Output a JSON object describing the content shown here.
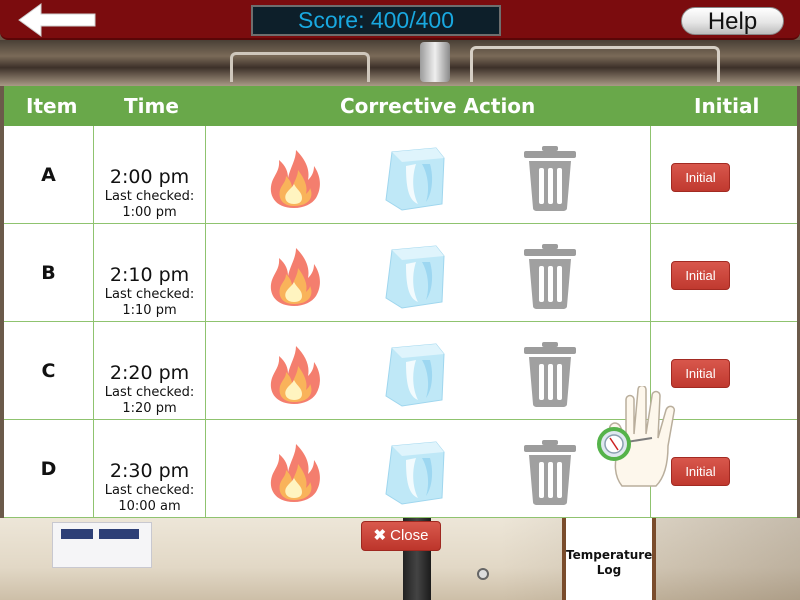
{
  "header": {
    "back_icon": "left-arrow-icon",
    "score": "Score: 400/400",
    "help_label": "Help"
  },
  "table": {
    "columns": [
      "Item",
      "Time",
      "Corrective Action",
      "Initial"
    ],
    "rows": [
      {
        "item": "A",
        "time": "2:00 pm",
        "last_checked_label": "Last checked:",
        "last_checked": "1:00 pm",
        "initial_label": "Initial"
      },
      {
        "item": "B",
        "time": "2:10 pm",
        "last_checked_label": "Last checked:",
        "last_checked": "1:10 pm",
        "initial_label": "Initial"
      },
      {
        "item": "C",
        "time": "2:20 pm",
        "last_checked_label": "Last checked:",
        "last_checked": "1:20 pm",
        "initial_label": "Initial"
      },
      {
        "item": "D",
        "time": "2:30 pm",
        "last_checked_label": "Last checked:",
        "last_checked": "10:00 am",
        "initial_label": "Initial"
      }
    ],
    "action_icons": [
      "fire-icon",
      "ice-cube-icon",
      "trash-can-icon"
    ]
  },
  "footer": {
    "close_label": "Close",
    "close_icon": "x-icon",
    "temperature_log_label": "Temperature Log"
  },
  "colors": {
    "top_bar": "#7b0c0e",
    "score_text": "#19a8e0",
    "header_green": "#69a84a",
    "grid_green": "#8fc36f",
    "button_red": "#c0392f"
  }
}
